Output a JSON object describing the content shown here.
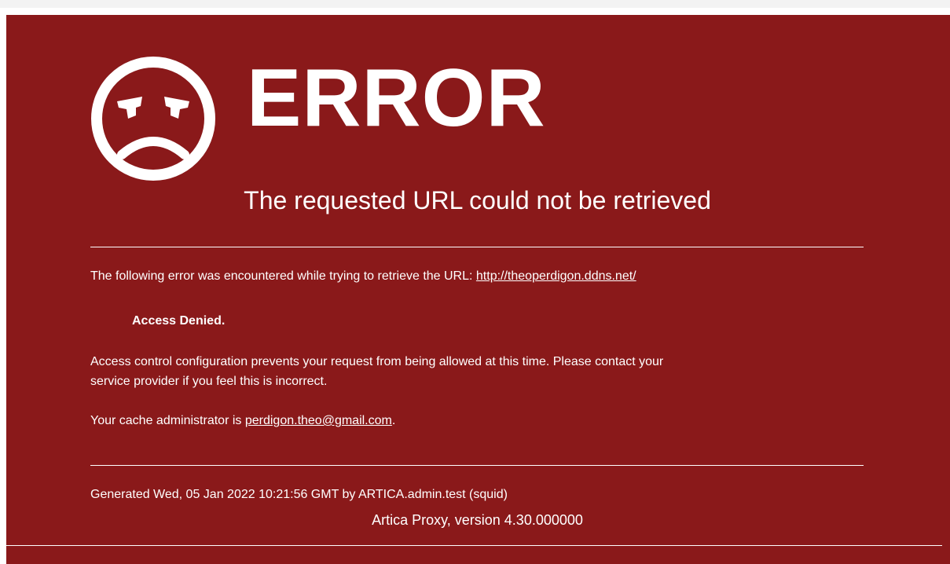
{
  "error_title": "ERROR",
  "subtitle": "The requested URL could not be retrieved",
  "message": {
    "intro": "The following error was encountered while trying to retrieve the URL: ",
    "url": "http://theoperdigon.ddns.net/",
    "denied": "Access Denied.",
    "explanation_line1": "Access control configuration prevents your request from being allowed at this time. Please contact your",
    "explanation_line2": "service provider if you feel this is incorrect.",
    "admin_prefix": "Your cache administrator is ",
    "admin_email": "perdigon.theo@gmail.com",
    "admin_suffix": "."
  },
  "footer": {
    "generated": "Generated Wed, 05 Jan 2022 10:21:56 GMT by ARTICA.admin.test (squid)",
    "version": "Artica Proxy, version 4.30.000000"
  },
  "colors": {
    "background": "#8a191a",
    "text": "#ffffff"
  },
  "icons": {
    "face": "sad-face-icon"
  }
}
